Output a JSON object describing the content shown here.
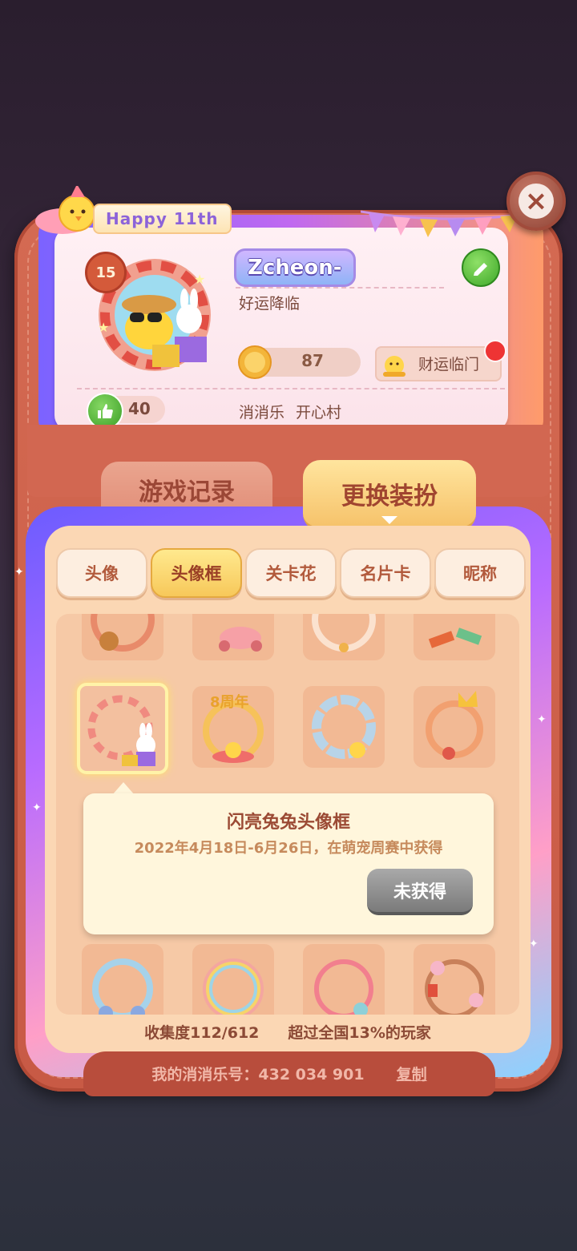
{
  "header": {
    "event_tag": "Happy 11th",
    "close_icon": "close-icon"
  },
  "profile": {
    "level": "15",
    "nickname": "Zcheon-",
    "motto": "好运降临",
    "coins": "87",
    "luck_label": "财运临门",
    "likes": "40",
    "location_game": "消消乐",
    "location_village": "开心村",
    "edit_icon": "pencil-icon"
  },
  "main_tabs": {
    "records": "游戏记录",
    "dressup": "更换装扮"
  },
  "sub_tabs": [
    {
      "label": "头像",
      "active": false
    },
    {
      "label": "头像框",
      "active": true
    },
    {
      "label": "关卡花",
      "active": false
    },
    {
      "label": "名片卡",
      "active": false
    },
    {
      "label": "昵称",
      "active": false
    }
  ],
  "tooltip": {
    "title": "闪亮兔兔头像框",
    "description": "2022年4月18日-6月26日，在萌宠周赛中获得",
    "button": "未获得"
  },
  "grid_badges": {
    "anniversary": "8周年"
  },
  "stats": {
    "collection": "收集度112/612",
    "ranking": "超过全国13%的玩家"
  },
  "footer": {
    "account_label": "我的消消乐号：432 034 901",
    "copy": "复制"
  },
  "colors": {
    "leather": "#c85a45",
    "panel": "#fbd7b4",
    "active_tab": "#f7c85a",
    "accent_text": "#9b4a34"
  }
}
